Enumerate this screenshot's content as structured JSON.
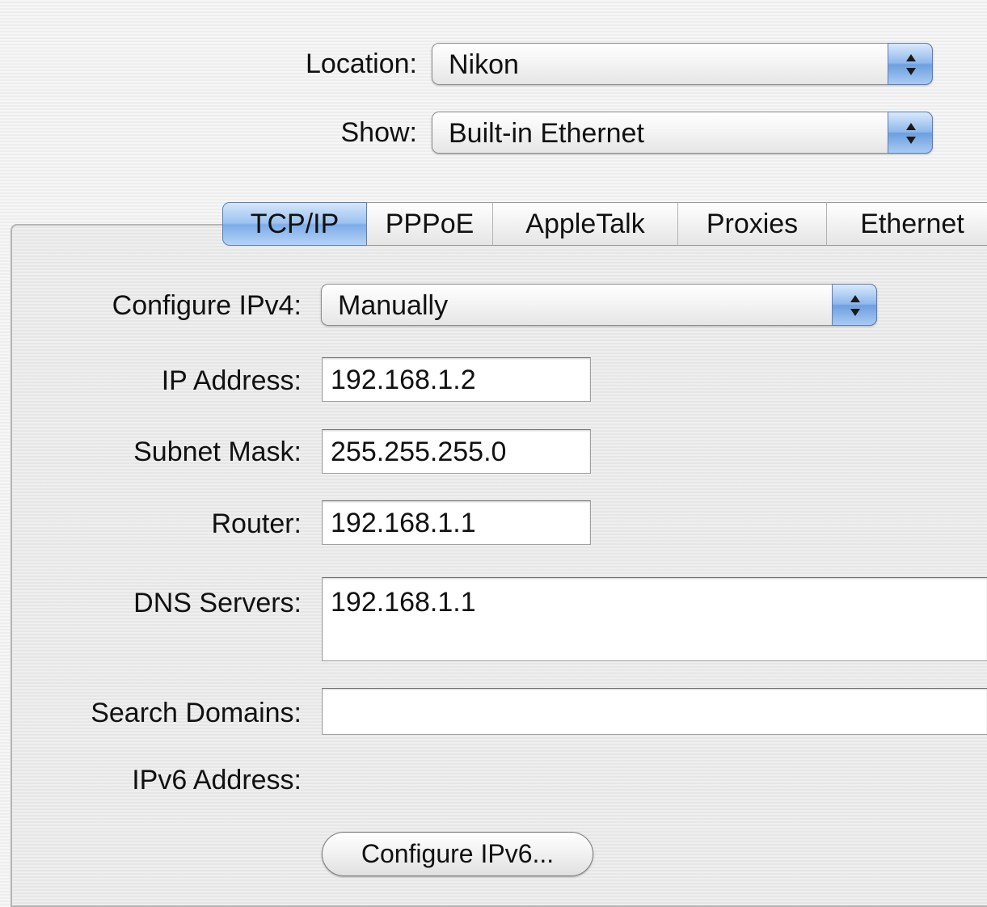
{
  "location": {
    "label": "Location:",
    "value": "Nikon"
  },
  "show": {
    "label": "Show:",
    "value": "Built-in Ethernet"
  },
  "tabs": [
    {
      "label": "TCP/IP",
      "active": true
    },
    {
      "label": "PPPoE",
      "active": false
    },
    {
      "label": "AppleTalk",
      "active": false
    },
    {
      "label": "Proxies",
      "active": false
    },
    {
      "label": "Ethernet",
      "active": false
    }
  ],
  "configure_ipv4": {
    "label": "Configure IPv4:",
    "value": "Manually"
  },
  "ip_address": {
    "label": "IP Address:",
    "value": "192.168.1.2"
  },
  "subnet_mask": {
    "label": "Subnet Mask:",
    "value": "255.255.255.0"
  },
  "router": {
    "label": "Router:",
    "value": "192.168.1.1"
  },
  "dns_servers": {
    "label": "DNS Servers:",
    "value": "192.168.1.1"
  },
  "search_domains": {
    "label": "Search Domains:",
    "value": ""
  },
  "ipv6_address": {
    "label": "IPv6 Address:"
  },
  "configure_ipv6_button": {
    "label": "Configure IPv6..."
  },
  "colors": {
    "accent_blue": "#7cacea",
    "panel_bg": "#e6e6e6"
  },
  "icons": {
    "popup_arrows": "up-down-arrows-icon"
  }
}
